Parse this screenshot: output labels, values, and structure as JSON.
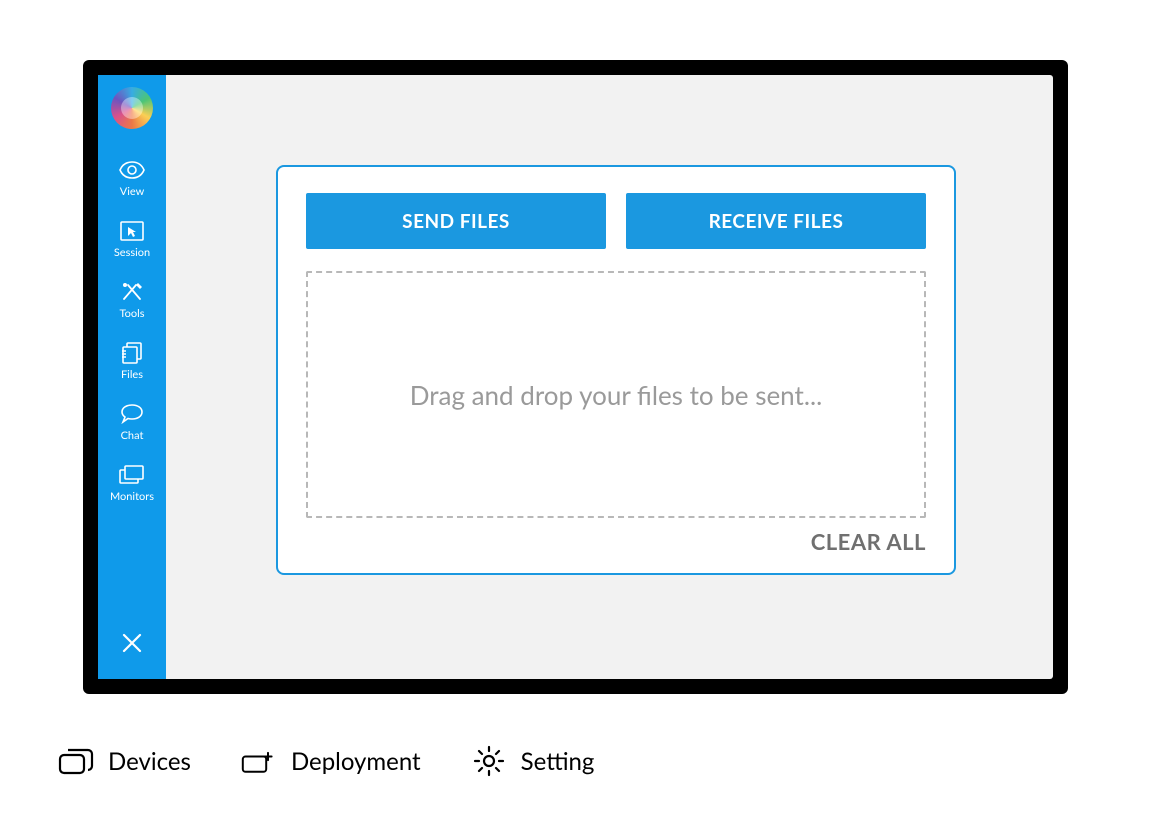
{
  "sidebar": {
    "items": [
      {
        "label": "View"
      },
      {
        "label": "Session"
      },
      {
        "label": "Tools"
      },
      {
        "label": "Files"
      },
      {
        "label": "Chat"
      },
      {
        "label": "Monitors"
      }
    ]
  },
  "panel": {
    "send_label": "SEND FILES",
    "receive_label": "RECEIVE FILES",
    "drop_hint": "Drag and drop your files to be sent...",
    "clear_label": "CLEAR ALL"
  },
  "bottom": {
    "devices": "Devices",
    "deployment": "Deployment",
    "setting": "Setting"
  },
  "colors": {
    "accent": "#1b98e0",
    "sidebar": "#0f9aea"
  }
}
